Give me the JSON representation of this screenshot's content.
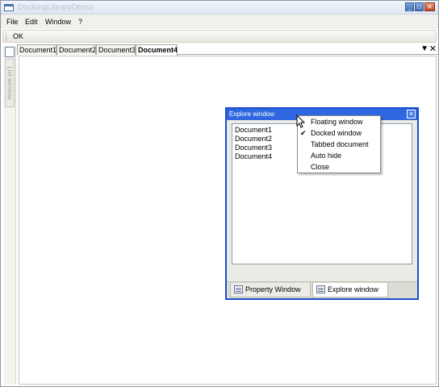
{
  "window": {
    "title": "DockingLibraryDemo",
    "controls": {
      "minimize": "_",
      "maximize": "□",
      "close": "✕"
    }
  },
  "menubar": {
    "items": [
      "File",
      "Edit",
      "Window",
      "?"
    ]
  },
  "toolbar": {
    "ok_label": "OK"
  },
  "sidebar": {
    "tab_label": "List window"
  },
  "documents": {
    "tabs": [
      "Document1",
      "Document2",
      "Document3",
      "Document4"
    ],
    "active_tab": "Document4",
    "menu_glyph": "▼",
    "close_glyph": "✕"
  },
  "explore_window": {
    "title": "Explore window",
    "close_glyph": "✕",
    "items": [
      "Document1",
      "Document2",
      "Document3",
      "Document4"
    ],
    "tabs": [
      "Property Window",
      "Explore window"
    ],
    "active_tab": "Explore window"
  },
  "context_menu": {
    "items": [
      "Floating window",
      "Docked window",
      "Tabbed document",
      "Auto hide",
      "Close"
    ],
    "checked_item": "Docked window",
    "check_glyph": "✔"
  },
  "colors": {
    "title_bar_blue": "#2f67e0",
    "float_border": "#1a4fcf",
    "title_text_grey": "#b8c4d4"
  }
}
